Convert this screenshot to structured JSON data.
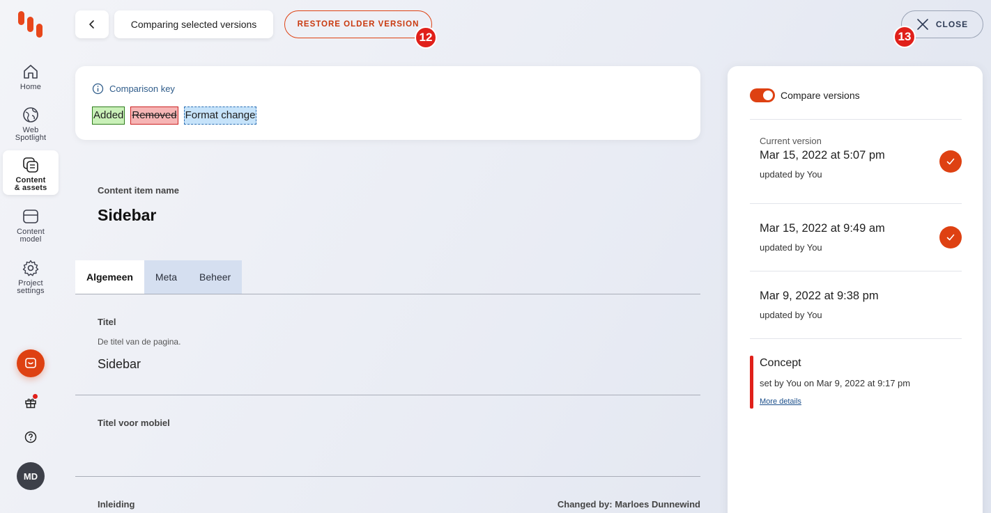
{
  "nav": {
    "items": [
      {
        "label": "Home",
        "icon": "home-icon"
      },
      {
        "label": "Web\nSpotlight",
        "icon": "globe-icon"
      },
      {
        "label": "Content\n& assets",
        "icon": "content-assets-icon"
      },
      {
        "label": "Content\nmodel",
        "icon": "content-model-icon"
      },
      {
        "label": "Project\nsettings",
        "icon": "gear-icon"
      }
    ],
    "avatar_initials": "MD"
  },
  "topbar": {
    "breadcrumb": "Comparing selected versions",
    "restore_label": "RESTORE OLDER VERSION",
    "restore_badge": "12",
    "close_label": "CLOSE",
    "close_badge": "13"
  },
  "comparison_key": {
    "title": "Comparison key",
    "added": "Added",
    "removed": "Removed",
    "format_change": "Format change"
  },
  "content_item": {
    "name_label": "Content item name",
    "name": "Sidebar",
    "tabs": [
      "Algemeen",
      "Meta",
      "Beheer"
    ],
    "active_tab": "Algemeen",
    "fields": {
      "titel_label": "Titel",
      "titel_help": "De titel van de pagina.",
      "titel_value": "Sidebar",
      "titel_mobiel_label": "Titel voor mobiel",
      "inleiding_label": "Inleiding",
      "changed_by": "Changed by: Marloes Dunnewind"
    }
  },
  "panel": {
    "compare_label": "Compare versions",
    "versions": [
      {
        "caption": "Current version",
        "date": "Mar 15, 2022 at 5:07 pm",
        "by": "updated by You",
        "selected": true
      },
      {
        "caption": "",
        "date": "Mar 15, 2022 at 9:49 am",
        "by": "updated by You",
        "selected": true
      },
      {
        "caption": "",
        "date": "Mar 9, 2022 at 9:38 pm",
        "by": "updated by You",
        "selected": false
      }
    ],
    "concept": {
      "title": "Concept",
      "by": "set by You on Mar 9, 2022 at 9:17 pm",
      "link": "More details"
    }
  },
  "colors": {
    "accent": "#de4112",
    "badge": "#e0201a",
    "link": "#1a4e8a"
  }
}
